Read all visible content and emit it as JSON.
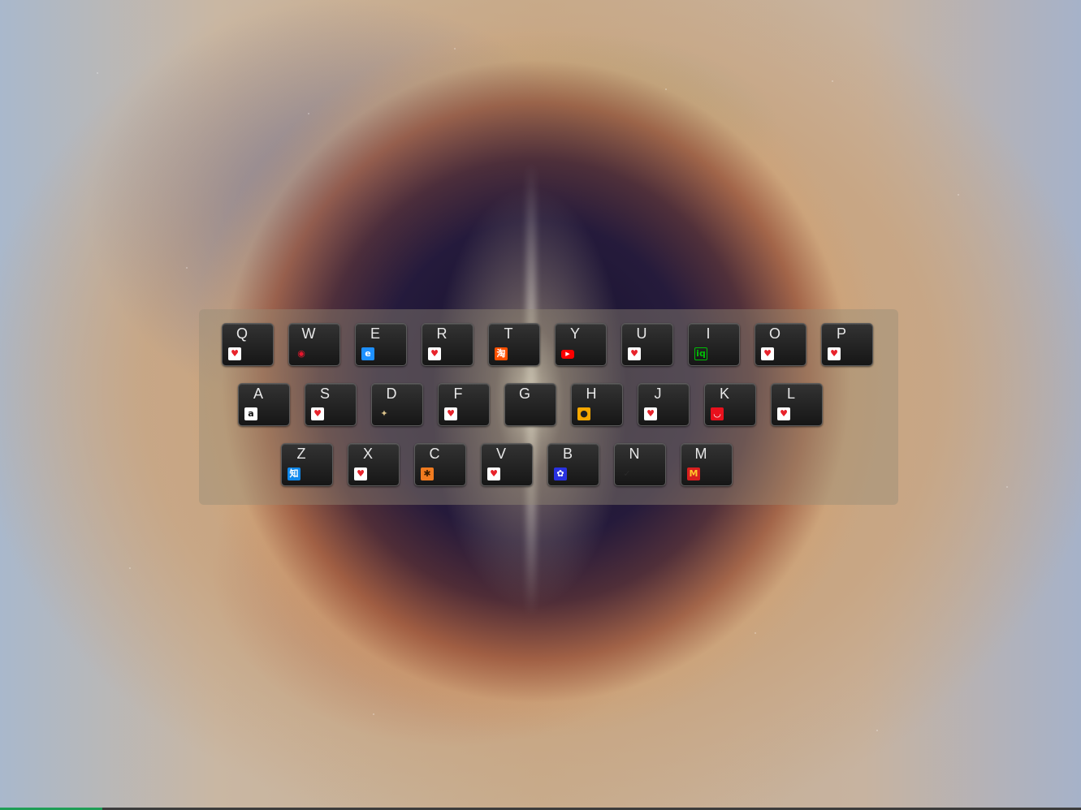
{
  "keyboard": {
    "rows": [
      [
        {
          "letter": "Q",
          "icon": "heart-icon"
        },
        {
          "letter": "W",
          "icon": "weibo-icon"
        },
        {
          "letter": "E",
          "icon": "ie-browser-icon"
        },
        {
          "letter": "R",
          "icon": "heart-icon"
        },
        {
          "letter": "T",
          "icon": "taobao-icon"
        },
        {
          "letter": "Y",
          "icon": "youtube-icon"
        },
        {
          "letter": "U",
          "icon": "heart-icon"
        },
        {
          "letter": "I",
          "icon": "iqiyi-icon"
        },
        {
          "letter": "O",
          "icon": "heart-icon"
        },
        {
          "letter": "P",
          "icon": "heart-icon"
        }
      ],
      [
        {
          "letter": "A",
          "icon": "amazon-icon"
        },
        {
          "letter": "S",
          "icon": "heart-icon"
        },
        {
          "letter": "D",
          "icon": "eagle-icon"
        },
        {
          "letter": "F",
          "icon": "heart-icon"
        },
        {
          "letter": "G",
          "icon": ""
        },
        {
          "letter": "H",
          "icon": "hupu-icon"
        },
        {
          "letter": "J",
          "icon": "heart-icon"
        },
        {
          "letter": "K",
          "icon": "lips-icon"
        },
        {
          "letter": "L",
          "icon": "heart-icon"
        }
      ],
      [
        {
          "letter": "Z",
          "icon": "zhihu-icon"
        },
        {
          "letter": "X",
          "icon": "heart-icon"
        },
        {
          "letter": "C",
          "icon": "asterisk-icon"
        },
        {
          "letter": "V",
          "icon": "heart-icon"
        },
        {
          "letter": "B",
          "icon": "baidu-icon"
        },
        {
          "letter": "N",
          "icon": "nike-icon"
        },
        {
          "letter": "M",
          "icon": "mcdonalds-icon"
        }
      ]
    ]
  },
  "colors": {
    "key_background": "#1c1c1c",
    "key_border": "#5b5b5b",
    "panel": "#968c78",
    "taskbar_accent": "#1e9e56"
  }
}
